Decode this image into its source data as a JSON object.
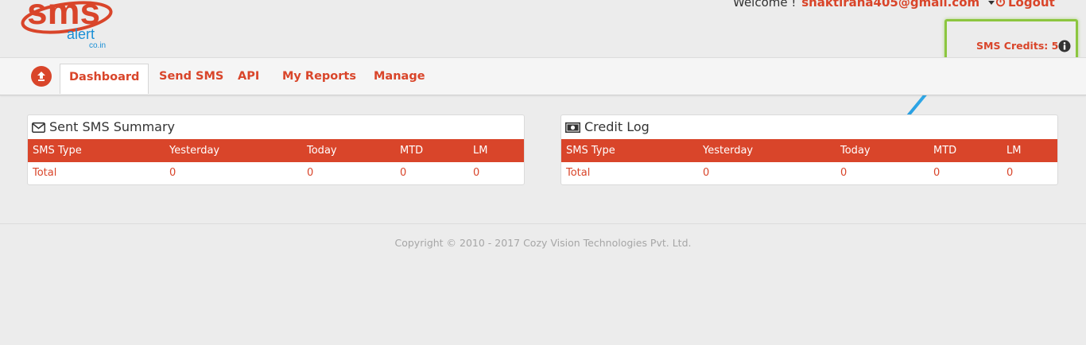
{
  "header": {
    "logo": {
      "main": "sms",
      "sub": "alert",
      "domain": "co.in"
    },
    "welcome_label": "Welcome !",
    "user_email": "shaktirana405@gmail.com",
    "logout_label": "Logout",
    "credits_label": "SMS Credits: 5"
  },
  "nav": {
    "items": [
      {
        "label": "Dashboard",
        "active": true
      },
      {
        "label": "Send SMS"
      },
      {
        "label": "API"
      },
      {
        "label": "My Reports"
      },
      {
        "label": "Manage"
      }
    ]
  },
  "panels": {
    "sent": {
      "title": "Sent SMS Summary",
      "headers": [
        "SMS Type",
        "Yesterday",
        "Today",
        "MTD",
        "LM"
      ],
      "rows": [
        [
          "Total",
          "0",
          "0",
          "0",
          "0"
        ]
      ]
    },
    "credit": {
      "title": "Credit Log",
      "headers": [
        "SMS Type",
        "Yesterday",
        "Today",
        "MTD",
        "LM"
      ],
      "rows": [
        [
          "Total",
          "0",
          "0",
          "0",
          "0"
        ]
      ]
    }
  },
  "footer": {
    "copyright": "Copyright © 2010 - 2017 Cozy Vision Technologies Pvt. Ltd."
  },
  "colors": {
    "accent": "#d9452a",
    "highlight": "#8cc63f",
    "arrow": "#1ea0e6"
  }
}
